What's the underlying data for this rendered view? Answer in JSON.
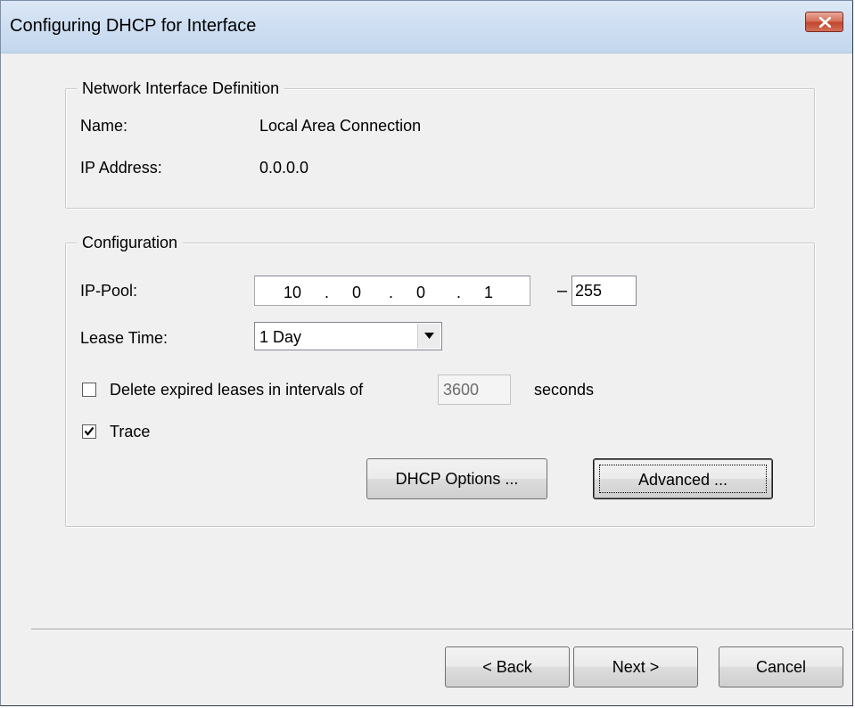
{
  "window": {
    "title": "Configuring DHCP for Interface",
    "close_icon": "close-icon"
  },
  "interface_group": {
    "legend": "Network Interface Definition",
    "name_label": "Name:",
    "name_value": "Local Area Connection",
    "ip_label": "IP Address:",
    "ip_value": "0.0.0.0"
  },
  "config_group": {
    "legend": "Configuration",
    "ip_pool_label": "IP-Pool:",
    "ip_pool": {
      "oct1": "10",
      "oct2": "0",
      "oct3": "0",
      "oct4": "1",
      "dot": "."
    },
    "range_dash": "–",
    "range_end": "255",
    "lease_label": "Lease Time:",
    "lease_value": "1 Day",
    "delete_expired": {
      "label": "Delete expired leases in intervals of",
      "checked": false,
      "interval": "3600",
      "unit": "seconds"
    },
    "trace": {
      "label": "Trace",
      "checked": true
    },
    "dhcp_options_button": "DHCP Options ...",
    "advanced_button": "Advanced ..."
  },
  "footer": {
    "back_button": "< Back",
    "next_button": "Next >",
    "cancel_button": "Cancel"
  },
  "colors": {
    "titlebar": "#c4d7ee",
    "close_button": "#c2452b",
    "dialog_bg": "#f0f0f0"
  }
}
